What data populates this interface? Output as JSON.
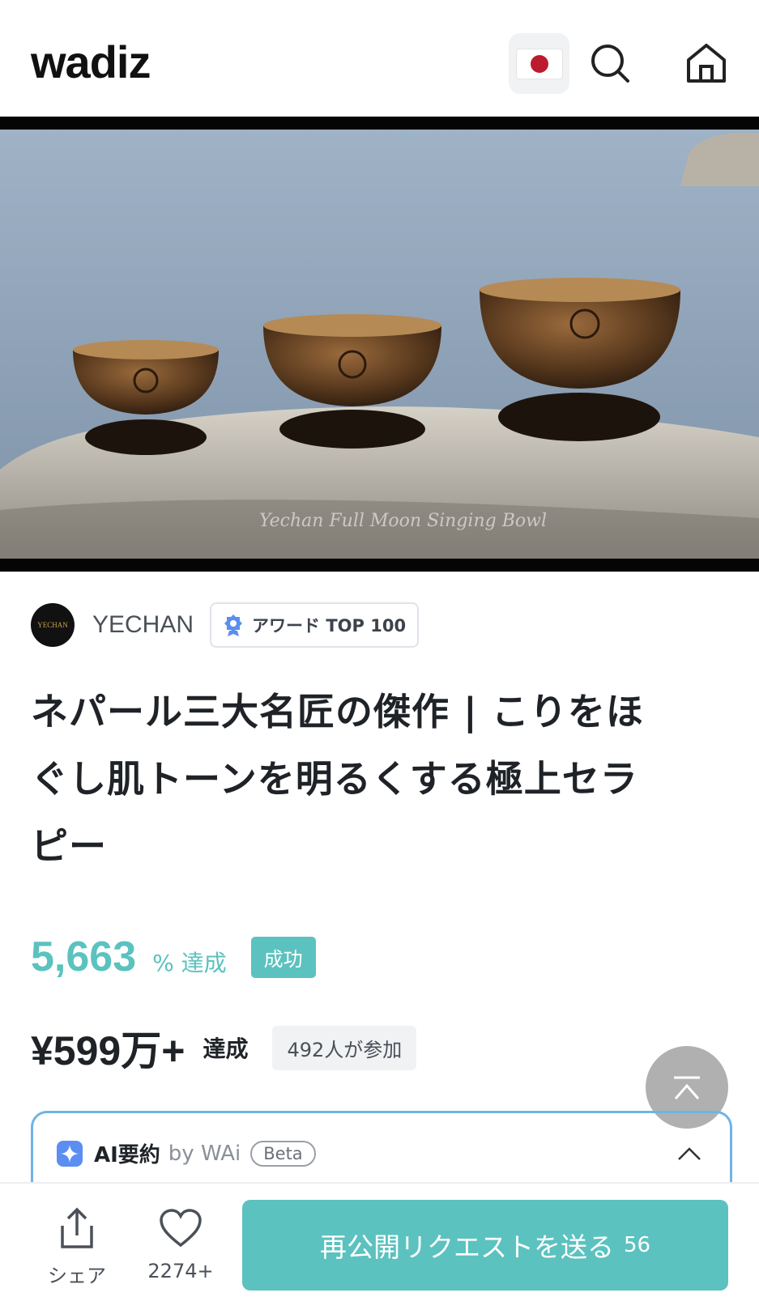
{
  "header": {
    "logo": "wadiz",
    "language_flag": "japan-flag-icon",
    "search_icon": "search-icon",
    "home_icon": "home-icon"
  },
  "hero": {
    "image_caption": "three singing bowls on a rock by the sea",
    "watermark_text": "Yechan Full Moon Singing Bowl"
  },
  "maker": {
    "name": "YECHAN",
    "avatar_text": "YECHAN",
    "badge_label": "アワード TOP 100"
  },
  "project": {
    "title_lines": [
      "ネパール三大名匠の傑作 | こりをほ",
      "ぐし肌トーンを明るくする極上セラ",
      "ピー"
    ]
  },
  "funding": {
    "percent": "5,663",
    "percent_unit": "% 達成",
    "status": "成功",
    "amount": "¥599万+",
    "amount_label": "達成",
    "participants": "492人が参加"
  },
  "ai_summary": {
    "title": "AI要約",
    "by": "by WAi",
    "beta": "Beta"
  },
  "bottom_bar": {
    "share_label": "シェア",
    "like_count": "2274+",
    "cta_label": "再公開リクエストを送る",
    "cta_count": "56"
  },
  "colors": {
    "accent": "#5bc2bf",
    "flag_red": "#bc1a2e",
    "ai_border": "#6fb4e6"
  }
}
